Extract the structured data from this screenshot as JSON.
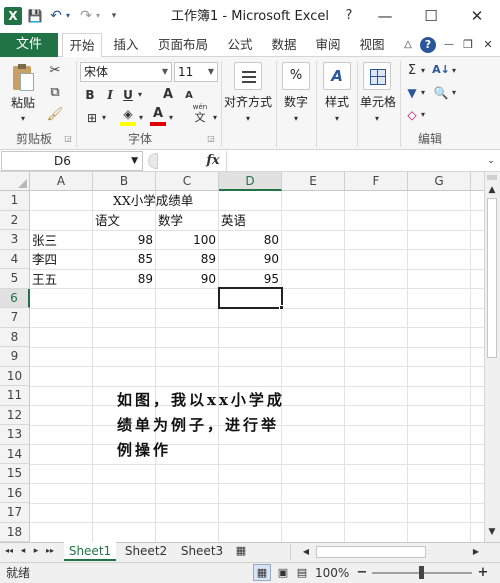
{
  "titlebar": {
    "title": "工作簿1 - Microsoft Excel",
    "app_icon": "X",
    "qa": {
      "save": "💾",
      "undo": "↶",
      "redo": "↷",
      "customize": "▾"
    },
    "win": {
      "help": "?",
      "minimize": "—",
      "maximize": "☐",
      "close": "✕"
    }
  },
  "tabs": {
    "file": "文件",
    "items": [
      "开始",
      "插入",
      "页面布局",
      "公式",
      "数据",
      "审阅",
      "视图"
    ],
    "right_icons": {
      "collapse": "△",
      "help": "?",
      "min": "—",
      "restore": "❐",
      "close": "✕"
    }
  },
  "ribbon": {
    "clipboard": {
      "paste": "粘贴",
      "label": "剪贴板"
    },
    "font": {
      "name": "宋体",
      "size": "11",
      "bold": "B",
      "italic": "I",
      "underline": "U",
      "grow": "A",
      "shrink": "A",
      "label": "字体",
      "wen": "wén"
    },
    "align": {
      "label": "对齐方式"
    },
    "number": {
      "label": "数字",
      "icon": "%"
    },
    "styles": {
      "label": "样式",
      "icon": "A"
    },
    "cells": {
      "label": "单元格"
    },
    "edit": {
      "label": "编辑",
      "sum": "Σ"
    }
  },
  "formula_bar": {
    "namebox": "D6",
    "fx": "fx",
    "value": ""
  },
  "grid": {
    "columns": [
      "A",
      "B",
      "C",
      "D",
      "E",
      "F",
      "G"
    ],
    "selected_col": "D",
    "rows": [
      "1",
      "2",
      "3",
      "4",
      "5",
      "6",
      "7",
      "8",
      "9",
      "10",
      "11",
      "12",
      "13",
      "14",
      "15",
      "16",
      "17",
      "18"
    ],
    "selected_row": "6",
    "title": "XX小学成绩单",
    "headers": [
      "语文",
      "数学",
      "英语"
    ],
    "data": [
      {
        "name": "张三",
        "v": [
          "98",
          "100",
          "80"
        ]
      },
      {
        "name": "李四",
        "v": [
          "85",
          "89",
          "90"
        ]
      },
      {
        "name": "王五",
        "v": [
          "89",
          "90",
          "95"
        ]
      }
    ],
    "note_lines": [
      "如图，我以xx小学成",
      "绩单为例子，进行举",
      "例操作"
    ]
  },
  "sheets": {
    "tabs": [
      "Sheet1",
      "Sheet2",
      "Sheet3"
    ],
    "active": "Sheet1",
    "nav": [
      "◂◂",
      "◂",
      "▸",
      "▸▸"
    ]
  },
  "status": {
    "ready": "就绪",
    "zoom": "100%",
    "minus": "−",
    "plus": "+"
  },
  "colors": {
    "excel_green": "#217346",
    "accent_blue": "#2b579a"
  }
}
